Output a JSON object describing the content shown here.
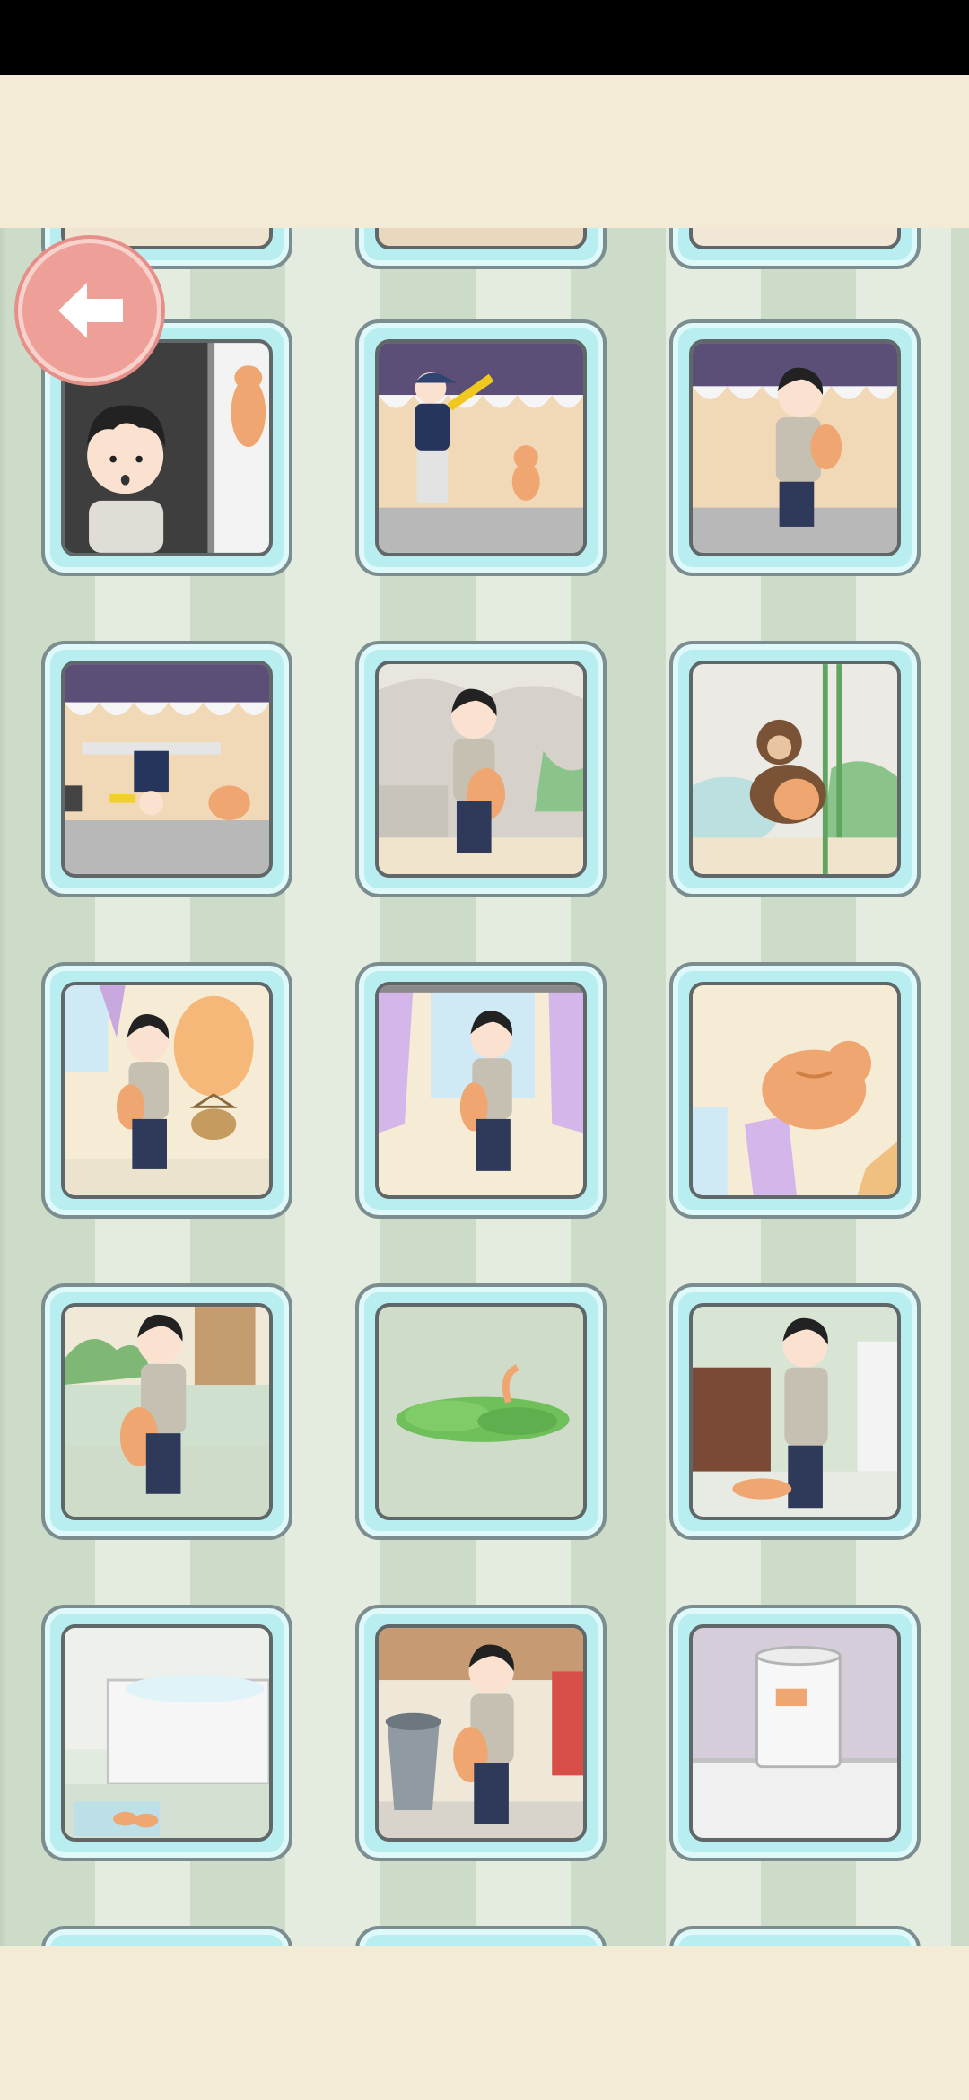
{
  "screen": "level-gallery",
  "back_button": {
    "icon": "left-arrow-icon",
    "color": "#ee9f98"
  },
  "colors": {
    "background": "#f4ebd6",
    "stripe_dark": "#cddcc9",
    "stripe_light": "#e4ecdf",
    "card_frame": "#b9eef0"
  },
  "levels": [
    {
      "scene": "boy-peeking-cat-on-door"
    },
    {
      "scene": "dancer-dabbing-cat"
    },
    {
      "scene": "boy-carrying-cat-wall"
    },
    {
      "scene": "breakdancer-headspin"
    },
    {
      "scene": "boy-holding-cat-fountain"
    },
    {
      "scene": "monkey-holding-cat"
    },
    {
      "scene": "boy-cat-balloon"
    },
    {
      "scene": "boy-cat-window"
    },
    {
      "scene": "fat-cat-jumping"
    },
    {
      "scene": "boy-holding-cat-garden"
    },
    {
      "scene": "cat-in-leaves"
    },
    {
      "scene": "boy-cat-bathroom"
    },
    {
      "scene": "bathtub-bubbles"
    },
    {
      "scene": "boy-cat-trash-can"
    },
    {
      "scene": "cat-in-tissue-roll"
    }
  ]
}
